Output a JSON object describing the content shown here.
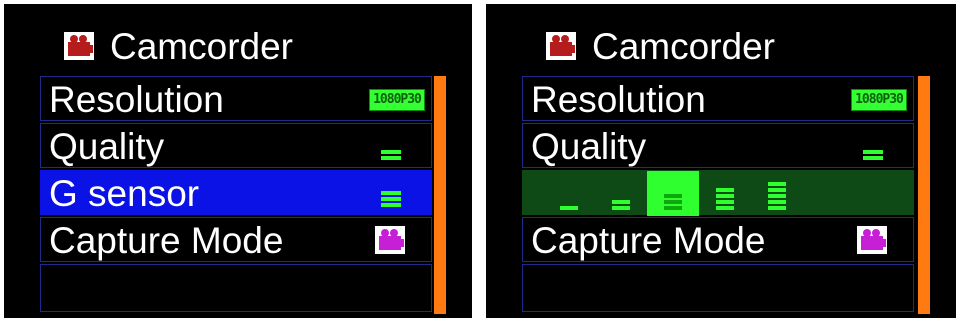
{
  "screens": [
    {
      "title": "Camcorder",
      "title_icon": "camcorder-icon",
      "rows": [
        {
          "label": "Resolution",
          "value_badge": "1080P30"
        },
        {
          "label": "Quality",
          "value_icon": "quality-bars-icon",
          "value_level": 2
        },
        {
          "label": "G sensor",
          "value_icon": "sensor-bars-icon",
          "value_level": 3,
          "selected": true
        },
        {
          "label": "Capture Mode",
          "value_icon": "camcorder-icon"
        },
        {
          "label": ""
        }
      ]
    },
    {
      "title": "Camcorder",
      "title_icon": "camcorder-icon",
      "rows": [
        {
          "label": "Resolution",
          "value_badge": "1080P30"
        },
        {
          "label": "Quality",
          "value_icon": "quality-bars-icon",
          "value_level": 2
        },
        {
          "label": "",
          "options": [
            1,
            2,
            3,
            4,
            5
          ],
          "selected_option": 3
        },
        {
          "label": "Capture Mode",
          "value_icon": "camcorder-icon"
        },
        {
          "label": ""
        }
      ]
    }
  ],
  "colors": {
    "menu_border": "#1e2b8a",
    "selected_row": "#0a12e6",
    "edit_row": "#0d4a16",
    "scrollbar": "#ff7a10",
    "level_green": "#2fff2f"
  }
}
